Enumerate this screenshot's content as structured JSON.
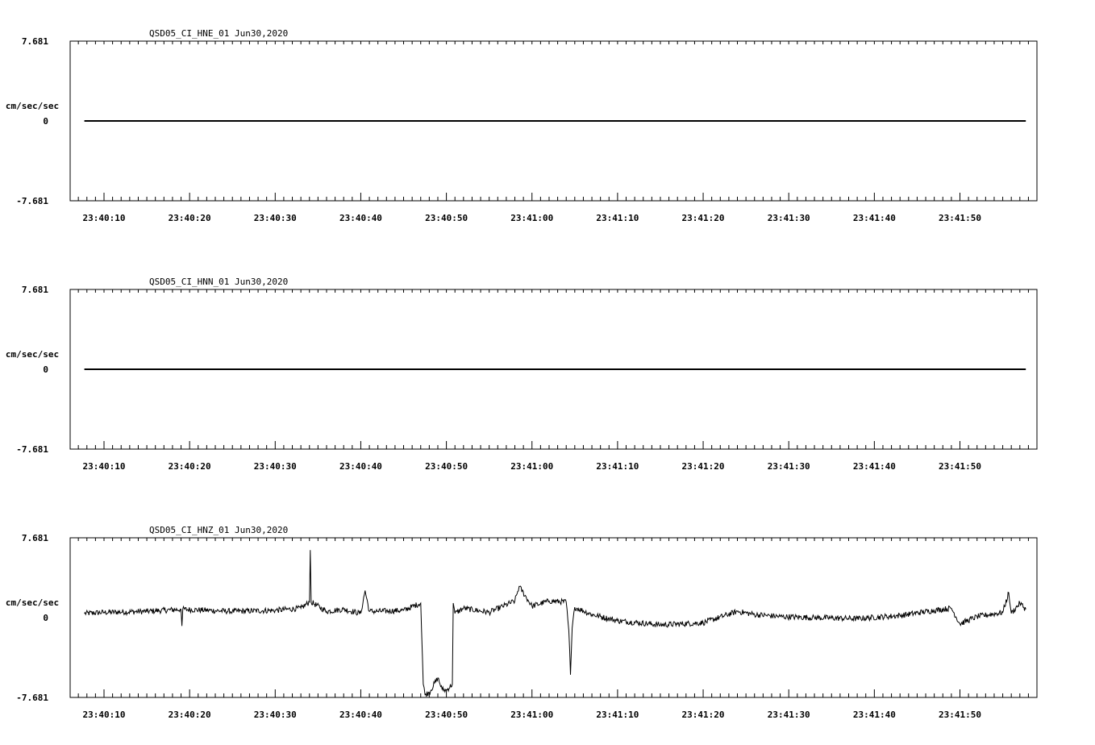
{
  "chart_data": [
    {
      "type": "line",
      "title": "QSD05_CI_HNE_01  Jun30,2020",
      "ylabel": "cm/sec/sec",
      "ylim": [
        -7.681,
        7.681
      ],
      "yticks": [
        "7.681",
        "0",
        "-7.681"
      ],
      "xlim": [
        "23:40:06",
        "23:41:58"
      ],
      "xticks": [
        "23:40:10",
        "23:40:20",
        "23:40:30",
        "23:40:40",
        "23:40:50",
        "23:41:00",
        "23:41:10",
        "23:41:20",
        "23:41:30",
        "23:41:40",
        "23:41:50"
      ],
      "grid": false,
      "series": [
        {
          "x": [
            "23:40:07.7",
            "23:41:57.7"
          ],
          "values": [
            0,
            0
          ]
        }
      ]
    },
    {
      "type": "line",
      "title": "QSD05_CI_HNN_01  Jun30,2020",
      "ylabel": "cm/sec/sec",
      "ylim": [
        -7.681,
        7.681
      ],
      "yticks": [
        "7.681",
        "0",
        "-7.681"
      ],
      "xlim": [
        "23:40:06",
        "23:41:58"
      ],
      "xticks": [
        "23:40:10",
        "23:40:20",
        "23:40:30",
        "23:40:40",
        "23:40:50",
        "23:41:00",
        "23:41:10",
        "23:41:20",
        "23:41:30",
        "23:41:40",
        "23:41:50"
      ],
      "grid": false,
      "series": [
        {
          "x": [
            "23:40:07.7",
            "23:41:57.7"
          ],
          "values": [
            0,
            0
          ]
        }
      ]
    },
    {
      "type": "line",
      "title": "QSD05_CI_HNZ_01  Jun30,2020",
      "ylabel": "cm/sec/sec",
      "ylim": [
        -7.681,
        7.681
      ],
      "yticks": [
        "7.681",
        "0",
        "-7.681"
      ],
      "xlim": [
        "23:40:06",
        "23:41:58"
      ],
      "xticks": [
        "23:40:10",
        "23:40:20",
        "23:40:30",
        "23:40:40",
        "23:40:50",
        "23:41:00",
        "23:41:10",
        "23:41:20",
        "23:41:30",
        "23:41:40",
        "23:41:50"
      ],
      "grid": false,
      "series": [
        {
          "x": [
            "23:40:07.7",
            "23:40:10",
            "23:40:15",
            "23:40:19",
            "23:40:19.1",
            "23:40:19.2",
            "23:40:25",
            "23:40:30",
            "23:40:33",
            "23:40:34",
            "23:40:34.1",
            "23:40:34.2",
            "23:40:36",
            "23:40:38",
            "23:40:40",
            "23:40:40.5",
            "23:40:41",
            "23:40:42",
            "23:40:45",
            "23:40:47",
            "23:40:47.3",
            "23:40:47.5",
            "23:40:48",
            "23:40:49",
            "23:40:49.5",
            "23:40:50",
            "23:40:50.7",
            "23:40:50.8",
            "23:40:51",
            "23:40:52",
            "23:40:55",
            "23:40:58",
            "23:40:58.5",
            "23:41:00",
            "23:41:02",
            "23:41:04",
            "23:41:04.3",
            "23:41:04.5",
            "23:41:04.7",
            "23:41:05",
            "23:41:07",
            "23:41:10",
            "23:41:15",
            "23:41:20",
            "23:41:24",
            "23:41:26",
            "23:41:29",
            "23:41:33",
            "23:41:38",
            "23:41:43",
            "23:41:47",
            "23:41:49",
            "23:41:50",
            "23:41:52",
            "23:41:55",
            "23:41:55.7",
            "23:41:56",
            "23:41:57",
            "23:41:57.7"
          ],
          "values": [
            0.4,
            0.5,
            0.6,
            0.8,
            -0.8,
            0.8,
            0.6,
            0.7,
            0.9,
            1.5,
            6.5,
            1.5,
            0.6,
            0.8,
            0.4,
            2.6,
            0.6,
            0.6,
            0.7,
            1.4,
            -6.4,
            -7.4,
            -7.2,
            -5.8,
            -6.9,
            -7.0,
            -6.4,
            1.4,
            0.4,
            0.9,
            0.5,
            1.6,
            3.0,
            1.1,
            1.6,
            1.5,
            -1.2,
            -5.5,
            -1.0,
            1.0,
            0.3,
            -0.3,
            -0.7,
            -0.5,
            0.6,
            0.3,
            0.1,
            0.0,
            -0.1,
            0.2,
            0.7,
            0.9,
            -0.6,
            0.1,
            0.5,
            2.4,
            0.4,
            1.4,
            0.8
          ]
        }
      ]
    }
  ]
}
